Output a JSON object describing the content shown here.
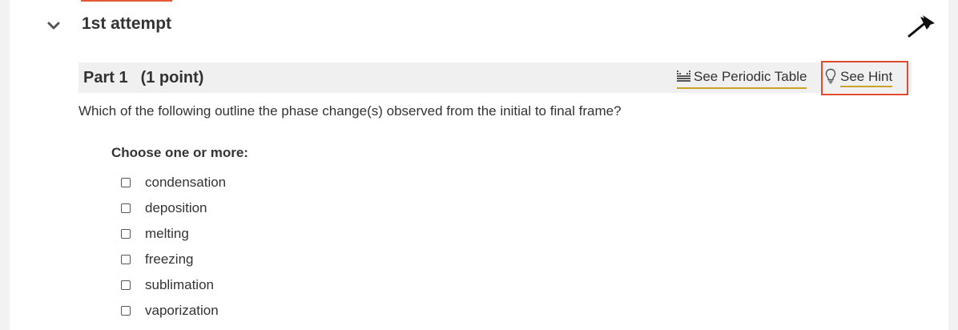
{
  "attempt": {
    "title": "1st attempt"
  },
  "part": {
    "label": "Part 1",
    "points": "(1 point)"
  },
  "links": {
    "periodic_table": "See Periodic Table",
    "hint": "See Hint"
  },
  "question": {
    "text": "Which of the following outline the phase change(s) observed from the initial to final frame?",
    "choose_label": "Choose one or more:",
    "options": [
      {
        "label": "condensation",
        "checked": false
      },
      {
        "label": "deposition",
        "checked": false
      },
      {
        "label": "melting",
        "checked": false
      },
      {
        "label": "freezing",
        "checked": false
      },
      {
        "label": "sublimation",
        "checked": false
      },
      {
        "label": "vaporization",
        "checked": false
      }
    ]
  },
  "colors": {
    "accent": "#e25b35",
    "link_underline": "#c9a227",
    "highlight_border": "#e04a2e"
  }
}
